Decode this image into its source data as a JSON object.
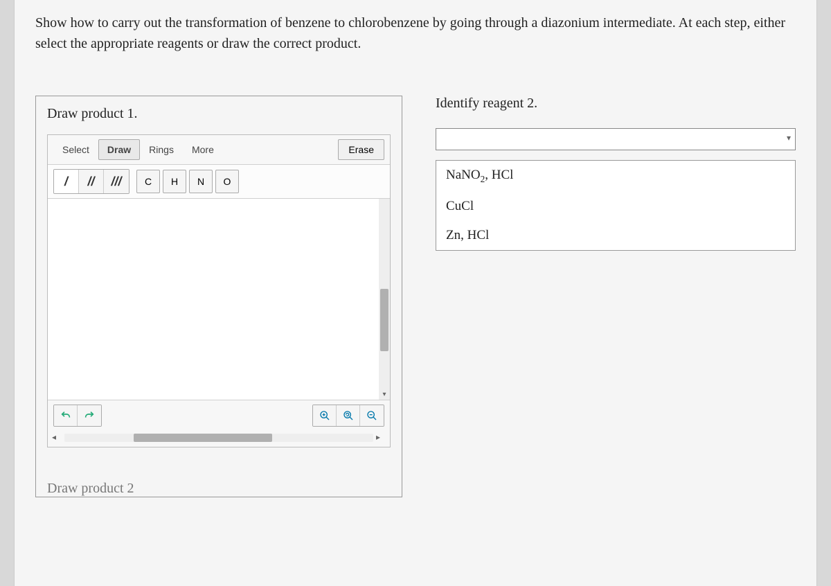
{
  "question": "Show how to carry out the transformation of benzene to chlorobenzene by going through a diazonium intermediate. At each step, either select the appropriate reagents or draw the correct product.",
  "left_panel": {
    "title": "Draw product 1.",
    "tabs": {
      "select": "Select",
      "draw": "Draw",
      "rings": "Rings",
      "more": "More"
    },
    "erase": "Erase",
    "bonds": {
      "single": "/",
      "double": "//",
      "triple": "///"
    },
    "atoms": {
      "c": "C",
      "h": "H",
      "n": "N",
      "o": "O"
    }
  },
  "right_panel": {
    "title": "Identify reagent 2.",
    "options": [
      "NaNO2, HCl",
      "CuCl",
      "Zn, HCl"
    ]
  },
  "cutoff_label": "Draw product 2"
}
